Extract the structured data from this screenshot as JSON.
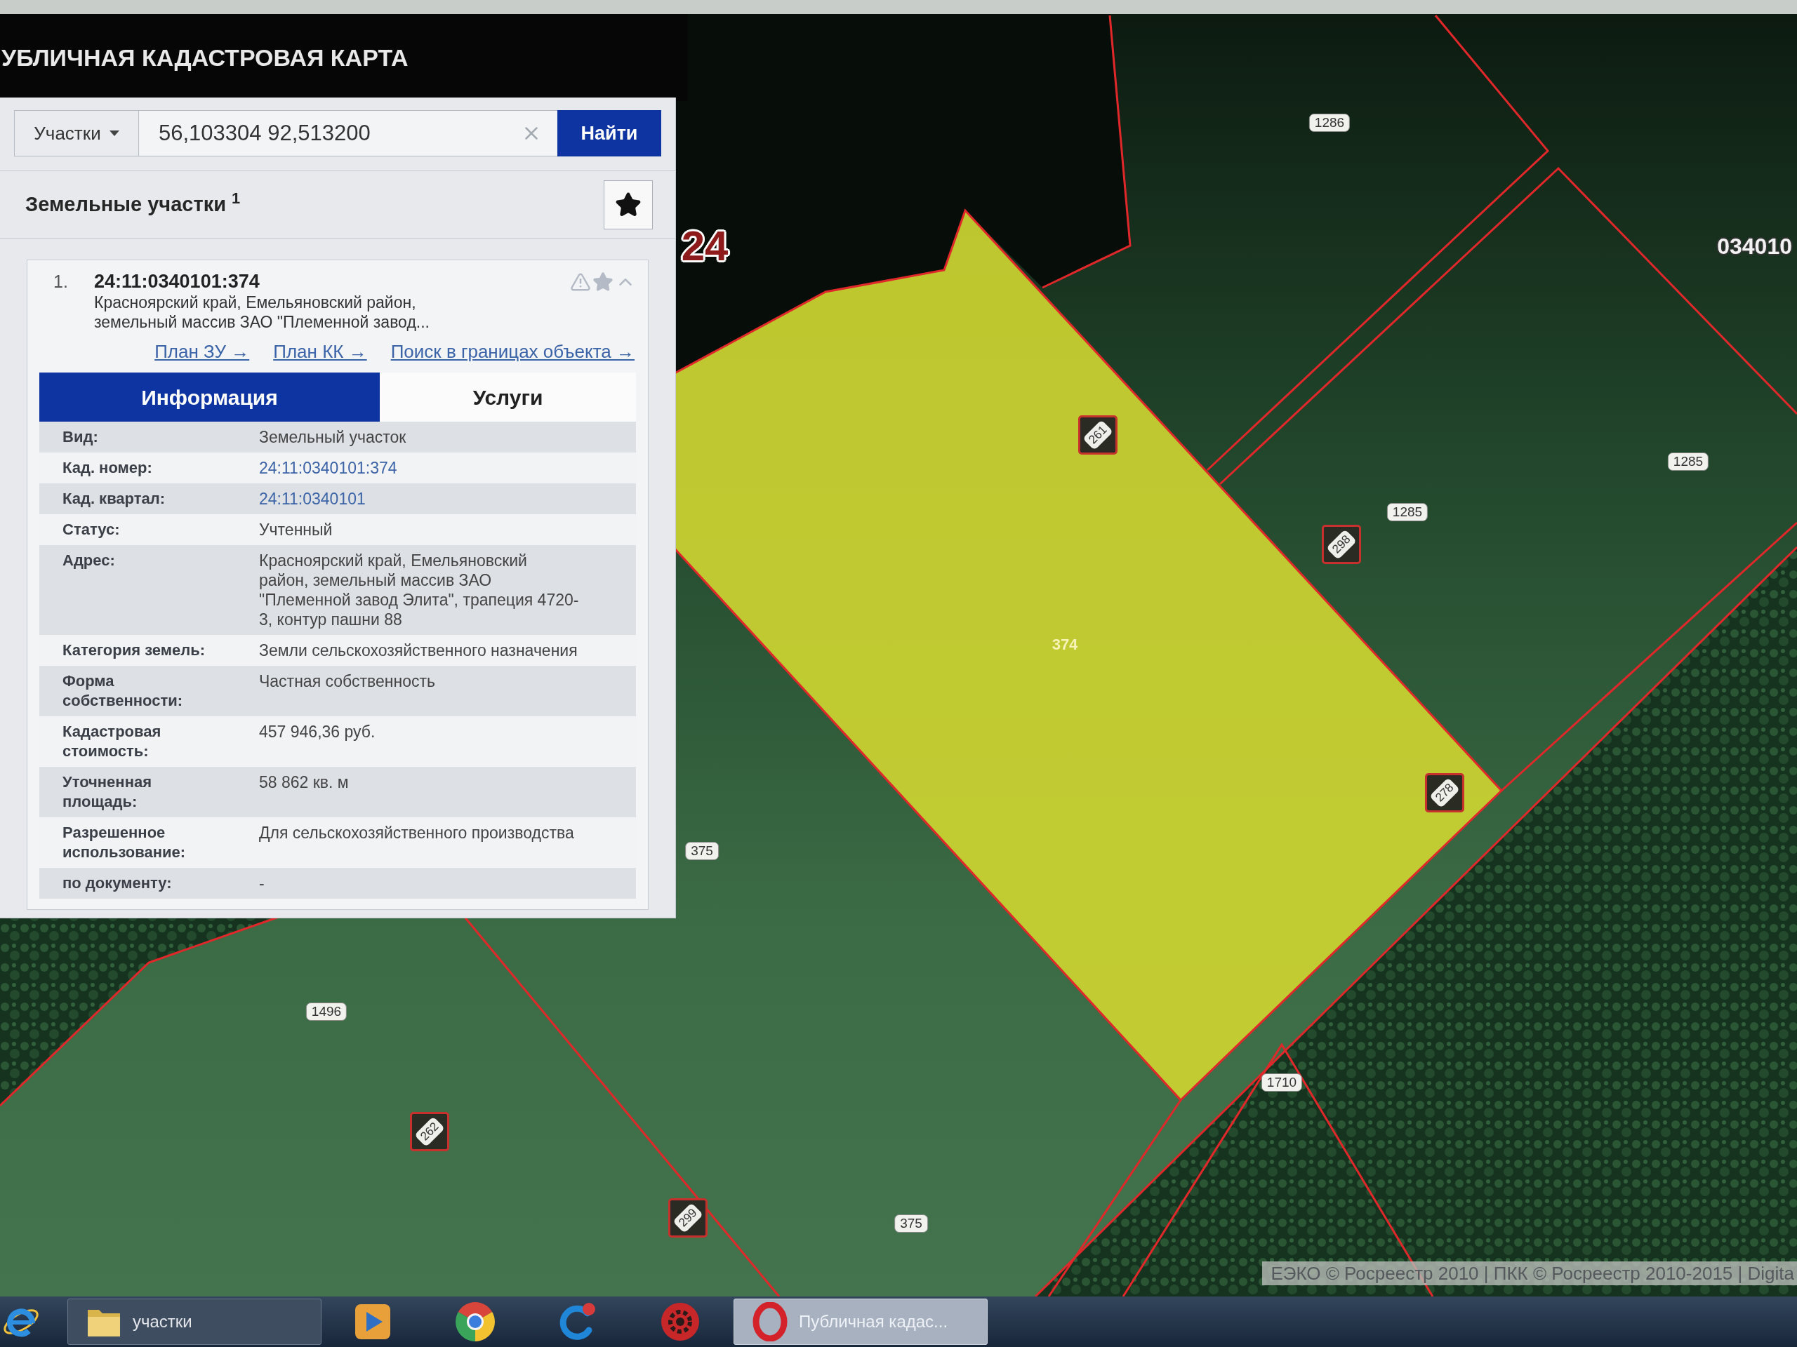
{
  "header": {
    "title": "УБЛИЧНАЯ КАДАСТРОВАЯ КАРТА"
  },
  "search": {
    "type_dropdown": "Участки",
    "value": "56,103304 92,513200",
    "submit": "Найти"
  },
  "results": {
    "title": "Земельные участки $^{1}$",
    "items": [
      {
        "index": "1.",
        "number": "24:11:0340101:374",
        "address": "Красноярский край, Емельяновский район,\nземельный массив ЗАО \"Племенной завод...",
        "expanded": true,
        "links": [
          "План ЗУ →",
          "План КК →",
          "Поиск в границах объекта →"
        ],
        "tabs": [
          {
            "label": "Информация",
            "selected": true
          },
          {
            "label": "Услуги",
            "selected": false
          }
        ],
        "fields": [
          {
            "label": "Вид:",
            "value": "Земельный участок",
            "kind": "text"
          },
          {
            "label": "Кад. номер:",
            "value": "24:11:0340101:374",
            "kind": "link"
          },
          {
            "label": "Кад. квартал:",
            "value": "24:11:0340101",
            "kind": "link"
          },
          {
            "label": "Статус:",
            "value": "Учтенный",
            "kind": "text"
          },
          {
            "label": "Адрес:",
            "value": "Красноярский край, Емельяновский\nрайон, земельный массив ЗАО\n\"Племенной завод Элита\", трапеция 4720-\n3, контур пашни 88",
            "kind": "text"
          },
          {
            "label": "Категория земель:",
            "value": "Земли сельскохозяйственного назначения",
            "kind": "text"
          },
          {
            "label": "Форма\nсобственности:",
            "value": "Частная собственность",
            "kind": "text"
          },
          {
            "label": "Кадастровая\nстоимость:",
            "value": "457 946,36 руб.",
            "kind": "text"
          },
          {
            "label": "Уточненная\nплощадь:",
            "value": "58 862 кв. м",
            "kind": "text"
          },
          {
            "label": "Разрешенное\nиспользование:",
            "value": "Для сельскохозяйственного производства",
            "kind": "text"
          },
          {
            "label": "по документу:",
            "value": "-",
            "kind": "text"
          }
        ]
      }
    ]
  },
  "map": {
    "labels": [
      {
        "kind": "region",
        "text": "24"
      },
      {
        "kind": "plain",
        "text": "1286"
      },
      {
        "kind": "quarter",
        "text": "034010"
      },
      {
        "kind": "tower",
        "text": "261"
      },
      {
        "kind": "plain",
        "text": "1285"
      },
      {
        "kind": "tower",
        "text": "298"
      },
      {
        "kind": "plain",
        "text": "1285"
      },
      {
        "kind": "selected",
        "text": "374"
      },
      {
        "kind": "tower",
        "text": "278"
      },
      {
        "kind": "plain",
        "text": "375"
      },
      {
        "kind": "plain",
        "text": "1496"
      },
      {
        "kind": "plain",
        "text": "1710"
      },
      {
        "kind": "tower",
        "text": "262"
      },
      {
        "kind": "tower",
        "text": "299"
      },
      {
        "kind": "plain",
        "text": "375"
      }
    ],
    "attribution": "ЕЭКО © Росреестр 2010 | ПКК © Росреестр 2010-2015 | Digita"
  },
  "taskbar": {
    "items": [
      {
        "kind": "launcher"
      },
      {
        "kind": "window",
        "label": "участки",
        "selected": false
      },
      {
        "kind": "launcher"
      },
      {
        "kind": "launcher"
      },
      {
        "kind": "launcher"
      },
      {
        "kind": "launcher"
      },
      {
        "kind": "window",
        "label": "Публичная кадас...",
        "selected": true
      }
    ]
  }
}
